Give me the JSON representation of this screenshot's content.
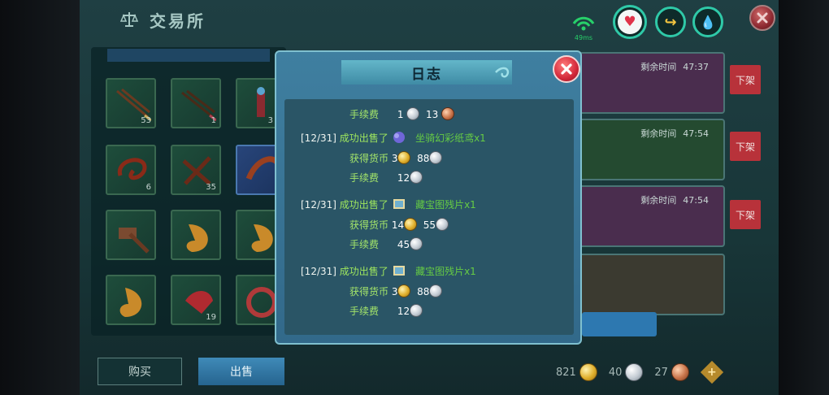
{
  "header": {
    "title": "交易所"
  },
  "status": {
    "ping": "49ms"
  },
  "inventory": {
    "slots": [
      {
        "count": "53"
      },
      {
        "count": "1"
      },
      {
        "count": "3"
      },
      {
        "count": "6"
      },
      {
        "count": "35"
      },
      {
        "count": ""
      },
      {
        "count": ""
      },
      {
        "count": ""
      },
      {
        "count": ""
      },
      {
        "count": ""
      },
      {
        "count": "19"
      },
      {
        "count": ""
      }
    ]
  },
  "listings": [
    {
      "remaining_label": "剩余时间",
      "time": "47:37",
      "action": "下架",
      "color": "#4a2d4e"
    },
    {
      "remaining_label": "剩余时间",
      "time": "47:54",
      "action": "下架",
      "color": "#244a30"
    },
    {
      "remaining_label": "剩余时间",
      "time": "47:54",
      "action": "下架",
      "color": "#4a2d4e"
    }
  ],
  "tabs": {
    "buy": "购买",
    "sell": "出售"
  },
  "currency": {
    "gold": "821",
    "silver": "40",
    "copper": "27"
  },
  "modal": {
    "title": "日志",
    "entries": [
      {
        "type": "fee",
        "label": "手续费",
        "values": [
          "1",
          "13"
        ]
      },
      {
        "type": "sale",
        "date": "[12/31]",
        "text": "成功出售了",
        "item": "坐骑幻彩纸鸢x1",
        "earned_label": "获得货币",
        "earned": [
          "3",
          "88"
        ],
        "fee_label": "手续费",
        "fee": "12"
      },
      {
        "type": "sale",
        "date": "[12/31]",
        "text": "成功出售了",
        "item": "藏宝图残片x1",
        "earned_label": "获得货币",
        "earned": [
          "14",
          "55"
        ],
        "fee_label": "手续费",
        "fee": "45"
      },
      {
        "type": "sale",
        "date": "[12/31]",
        "text": "成功出售了",
        "item": "藏宝图残片x1",
        "earned_label": "获得货币",
        "earned": [
          "3",
          "88"
        ],
        "fee_label": "手续费",
        "fee": "12"
      }
    ]
  },
  "colors": {
    "accent": "#2fc9a8",
    "close": "#d3283a",
    "fee_label": "#a4e56a",
    "item_name": "#66cc44"
  }
}
